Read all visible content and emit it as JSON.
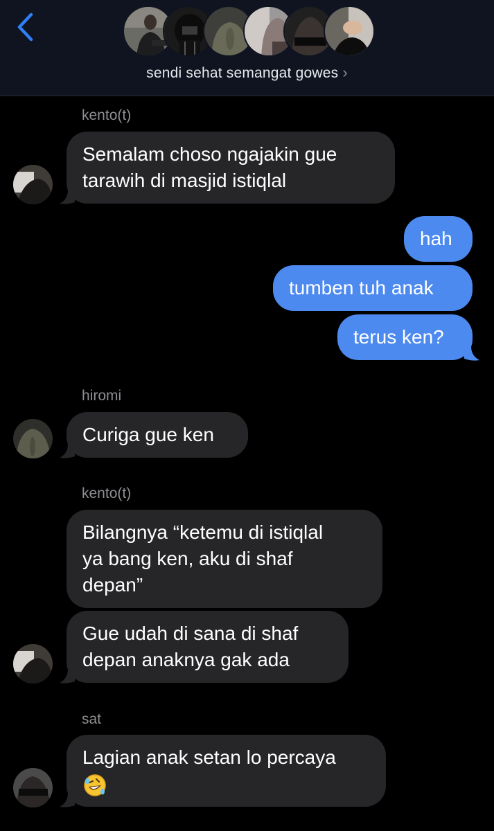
{
  "header": {
    "group_name": "sendi sehat semangat gowes",
    "chevron": "›",
    "back_icon": "chevron-left-icon",
    "member_avatar_count": 6
  },
  "messages": [
    {
      "direction": "in",
      "sender": "kento(t)",
      "lines": [
        "Semalam choso ngajakin gue",
        "tarawih di masjid istiqlal"
      ]
    },
    {
      "direction": "out",
      "lines": [
        "hah"
      ]
    },
    {
      "direction": "out",
      "lines": [
        "tumben tuh anak"
      ]
    },
    {
      "direction": "out",
      "lines": [
        "terus ken?"
      ]
    },
    {
      "direction": "in",
      "sender": "hiromi",
      "lines": [
        "Curiga gue ken"
      ]
    },
    {
      "direction": "in",
      "sender": "kento(t)",
      "lines": [
        "Bilangnya “ketemu di istiqlal",
        "ya bang ken, aku di shaf",
        "depan”"
      ]
    },
    {
      "direction": "in",
      "lines": [
        "Gue udah di sana di shaf",
        "depan anaknya gak ada"
      ]
    },
    {
      "direction": "in",
      "sender": "sat",
      "lines": [
        "Lagian anak setan lo percaya"
      ],
      "emoji": "rolling-on-the-floor-laughing-emoji"
    }
  ],
  "colors": {
    "background": "#000000",
    "header_bg": "#0f1420",
    "incoming_bubble": "#262629",
    "outgoing_bubble": "#4d8af0",
    "accent": "#2f7ff7",
    "sender_text": "#8e8e93"
  }
}
